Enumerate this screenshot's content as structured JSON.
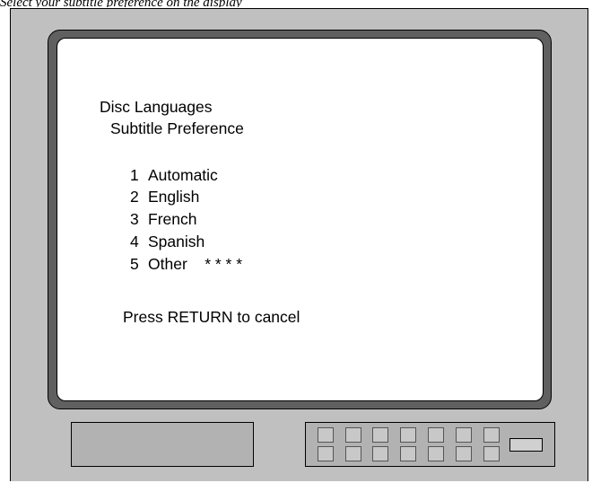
{
  "caption": "Select your subtitle preference on the display",
  "menu": {
    "title": "Disc Languages",
    "subtitle": "Subtitle Preference",
    "options": [
      {
        "number": "1",
        "label": "Automatic"
      },
      {
        "number": "2",
        "label": "English"
      },
      {
        "number": "3",
        "label": "French"
      },
      {
        "number": "4",
        "label": "Spanish"
      },
      {
        "number": "5",
        "label": "Other    * * * *"
      }
    ],
    "footer": "Press RETURN to cancel"
  },
  "colors": {
    "cabinet": "#c0c0c0",
    "bezel": "#606060",
    "screen": "#ffffff",
    "panel": "#b2b2b2"
  }
}
